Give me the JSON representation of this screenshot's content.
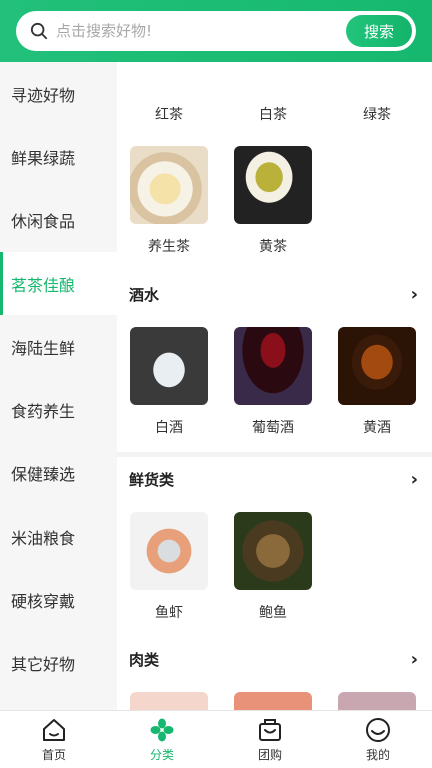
{
  "search": {
    "placeholder": "点击搜索好物!",
    "button_label": "搜索"
  },
  "sidebar": {
    "items": [
      {
        "label": "寻迹好物"
      },
      {
        "label": "鲜果绿蔬"
      },
      {
        "label": "休闲食品"
      },
      {
        "label": "茗茶佳酿",
        "active": true
      },
      {
        "label": "海陆生鲜"
      },
      {
        "label": "食药养生"
      },
      {
        "label": "保健臻选"
      },
      {
        "label": "米油粮食"
      },
      {
        "label": "硬核穿戴"
      },
      {
        "label": "其它好物"
      }
    ]
  },
  "content": {
    "tea_row1": [
      {
        "label": "红茶"
      },
      {
        "label": "白茶"
      },
      {
        "label": "绿茶"
      }
    ],
    "tea_row2": [
      {
        "label": "养生茶"
      },
      {
        "label": "黄茶"
      }
    ],
    "sections": [
      {
        "title": "酒水",
        "items": [
          {
            "label": "白酒"
          },
          {
            "label": "葡萄酒"
          },
          {
            "label": "黄酒"
          }
        ]
      },
      {
        "title": "鲜货类",
        "items": [
          {
            "label": "鱼虾"
          },
          {
            "label": "鲍鱼"
          }
        ]
      },
      {
        "title": "肉类",
        "items": []
      }
    ]
  },
  "tabbar": {
    "tabs": [
      {
        "label": "首页"
      },
      {
        "label": "分类",
        "active": true
      },
      {
        "label": "团购"
      },
      {
        "label": "我的"
      }
    ]
  },
  "colors": {
    "brand_green": "#16b86f",
    "sidebar_bg": "#f6f6f6"
  }
}
